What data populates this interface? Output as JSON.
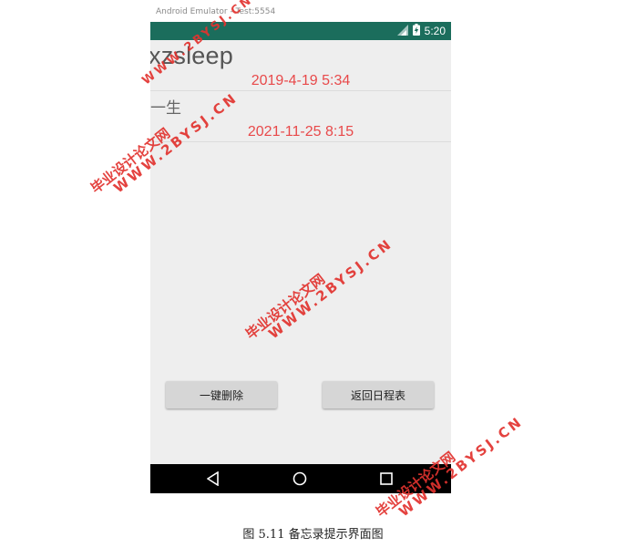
{
  "emulator": {
    "window_title": "Android Emulator - Test:5554"
  },
  "status_bar": {
    "time": "5:20",
    "icons": [
      "signal-icon",
      "battery-icon"
    ]
  },
  "app": {
    "title": "xzsleep",
    "title_overlap_text": "一生",
    "memo_items": [
      {
        "datetime": "2019-4-19 5:34"
      },
      {
        "datetime": "2021-11-25 8:15"
      }
    ],
    "buttons": {
      "delete_all": "一键删除",
      "back_to_schedule": "返回日程表"
    }
  },
  "nav_bar": {
    "buttons": [
      "back-icon",
      "home-icon",
      "recents-icon"
    ]
  },
  "caption": "图 5.11 备忘录提示界面图",
  "watermark": {
    "line1": "毕业设计论文网",
    "line2": "WWW.2BYSJ.CN",
    "color": "#e2332f"
  },
  "colors": {
    "status_bar": "#1b6d5c",
    "accent_text": "#e8494a",
    "background": "#eeeeee"
  }
}
